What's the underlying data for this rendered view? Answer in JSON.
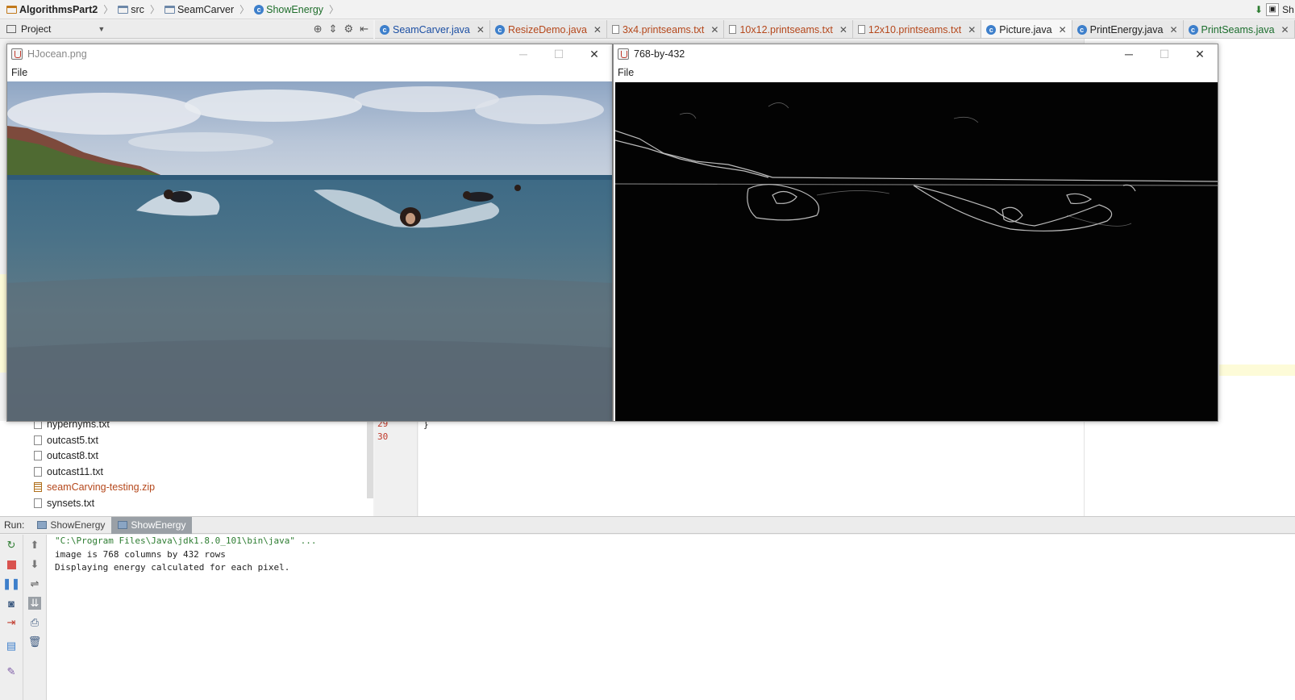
{
  "breadcrumb": {
    "project": "AlgorithmsPart2",
    "folder_src": "src",
    "folder_pkg": "SeamCarver",
    "class": "ShowEnergy",
    "right_label": "Sh"
  },
  "project_panel": {
    "title": "Project"
  },
  "editor_tabs": [
    {
      "label": "SeamCarver.java",
      "color": "#1c4fa3",
      "icon": "class-icon"
    },
    {
      "label": "ResizeDemo.java",
      "color": "#b5481c",
      "icon": "class-icon"
    },
    {
      "label": "3x4.printseams.txt",
      "color": "#b5481c",
      "icon": "text-file-icon"
    },
    {
      "label": "10x12.printseams.txt",
      "color": "#b5481c",
      "icon": "text-file-icon"
    },
    {
      "label": "12x10.printseams.txt",
      "color": "#b5481c",
      "icon": "text-file-icon"
    },
    {
      "label": "Picture.java",
      "color": "#222222",
      "icon": "class-icon"
    },
    {
      "label": "PrintEnergy.java",
      "color": "#222222",
      "icon": "class-icon"
    },
    {
      "label": "PrintSeams.java",
      "color": "#1c6e2e",
      "icon": "class-icon"
    }
  ],
  "tree_items": [
    {
      "label": "hypernyms.txt",
      "type": "text",
      "color": "#222"
    },
    {
      "label": "outcast5.txt",
      "type": "text",
      "color": "#222"
    },
    {
      "label": "outcast8.txt",
      "type": "text",
      "color": "#222"
    },
    {
      "label": "outcast11.txt",
      "type": "text",
      "color": "#222"
    },
    {
      "label": "seamCarving-testing.zip",
      "type": "zip",
      "color": "#b5481c"
    },
    {
      "label": "synsets.txt",
      "type": "text",
      "color": "#222"
    }
  ],
  "editor": {
    "line_numbers": [
      "29",
      "30"
    ],
    "code_line": "}"
  },
  "windows": {
    "left": {
      "title": "HJocean.png",
      "menu": "File"
    },
    "right": {
      "title": "768-by-432",
      "menu": "File"
    }
  },
  "run_panel": {
    "label": "Run:",
    "tabs": [
      "ShowEnergy",
      "ShowEnergy"
    ],
    "console_lines": [
      "\"C:\\Program Files\\Java\\jdk1.8.0_101\\bin\\java\" ...",
      "image is 768 columns by 432 rows",
      "Displaying energy calculated for each pixel."
    ]
  }
}
